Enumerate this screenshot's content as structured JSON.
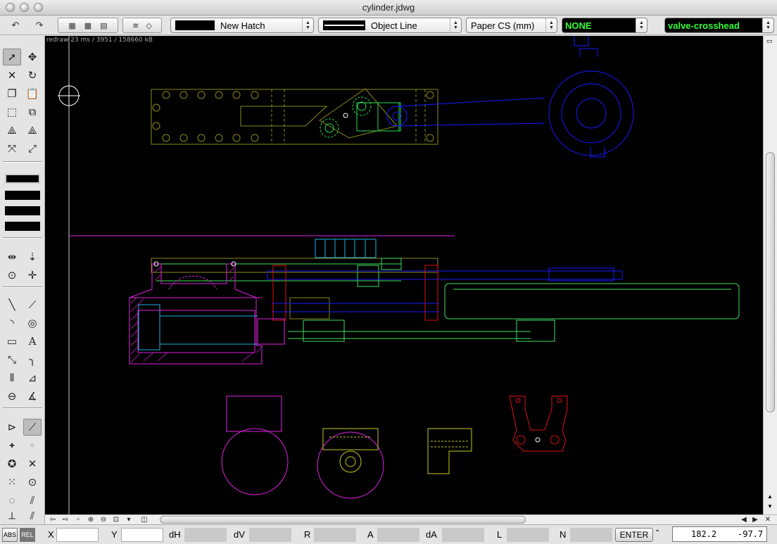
{
  "window": {
    "title": "cylinder.jdwg"
  },
  "toolbar": {
    "undo_icon": "undo-icon",
    "redo_icon": "redo-icon",
    "hatch_name": "New Hatch",
    "line_type": "Object Line",
    "coord_space": "Paper CS (mm)",
    "color_name": "NONE",
    "layer_name": "valve-crosshead"
  },
  "canvas": {
    "status_text": "redraw 23 ms / 3951 / 158660 kB",
    "background": "#000000",
    "colors": {
      "olive": "#8a8a1a",
      "yellow": "#c8c820",
      "green": "#20e050",
      "blue": "#1818ff",
      "magenta": "#e020e0",
      "cyan": "#20b0e0",
      "red": "#e01010",
      "lightgreen": "#40e060",
      "cursor": "#ffffff"
    }
  },
  "status": {
    "abs": "ABS",
    "rel": "REL",
    "x_label": "X",
    "y_label": "Y",
    "dh_label": "dH",
    "dv_label": "dV",
    "r_label": "R",
    "a_label": "A",
    "da_label": "dA",
    "l_label": "L",
    "n_label": "N",
    "enter_label": "ENTER",
    "coord_x": "182.2",
    "coord_y": "-97.7"
  }
}
